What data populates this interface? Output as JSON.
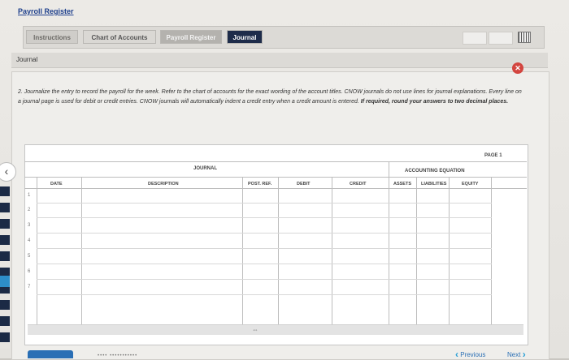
{
  "app": {
    "title": "Payroll Register"
  },
  "tabs": [
    {
      "label": "Instructions"
    },
    {
      "label": "Chart of Accounts"
    },
    {
      "label": "Payroll Register"
    },
    {
      "label": "Journal"
    }
  ],
  "section": {
    "label": "Journal"
  },
  "instructions": {
    "text": "2. Journalize the entry to record the payroll for the week. Refer to the chart of accounts for the exact wording of the account titles. CNOW journals do not use lines for journal explanations. Every line on a journal page is used for debit or credit entries. CNOW journals will automatically indent a credit entry when a credit amount is entered.",
    "emphasis": "If required, round your answers to two decimal places."
  },
  "journal": {
    "page_label": "PAGE 1",
    "title": "JOURNAL",
    "equation_title": "ACCOUNTING EQUATION",
    "columns": [
      "DATE",
      "DESCRIPTION",
      "POST. REF.",
      "DEBIT",
      "CREDIT",
      "ASSETS",
      "LIABILITIES",
      "EQUITY"
    ],
    "rows": [
      "1",
      "2",
      "3",
      "4",
      "5",
      "6",
      "7"
    ]
  },
  "nav": {
    "previous": "Previous",
    "next": "Next"
  },
  "icons": {
    "close": "close-icon",
    "grid": "grid-icon",
    "back": "chevron-left-icon"
  },
  "colors": {
    "accent": "#1e2c4a",
    "link": "#2a6fb5",
    "close": "#d3453f"
  }
}
